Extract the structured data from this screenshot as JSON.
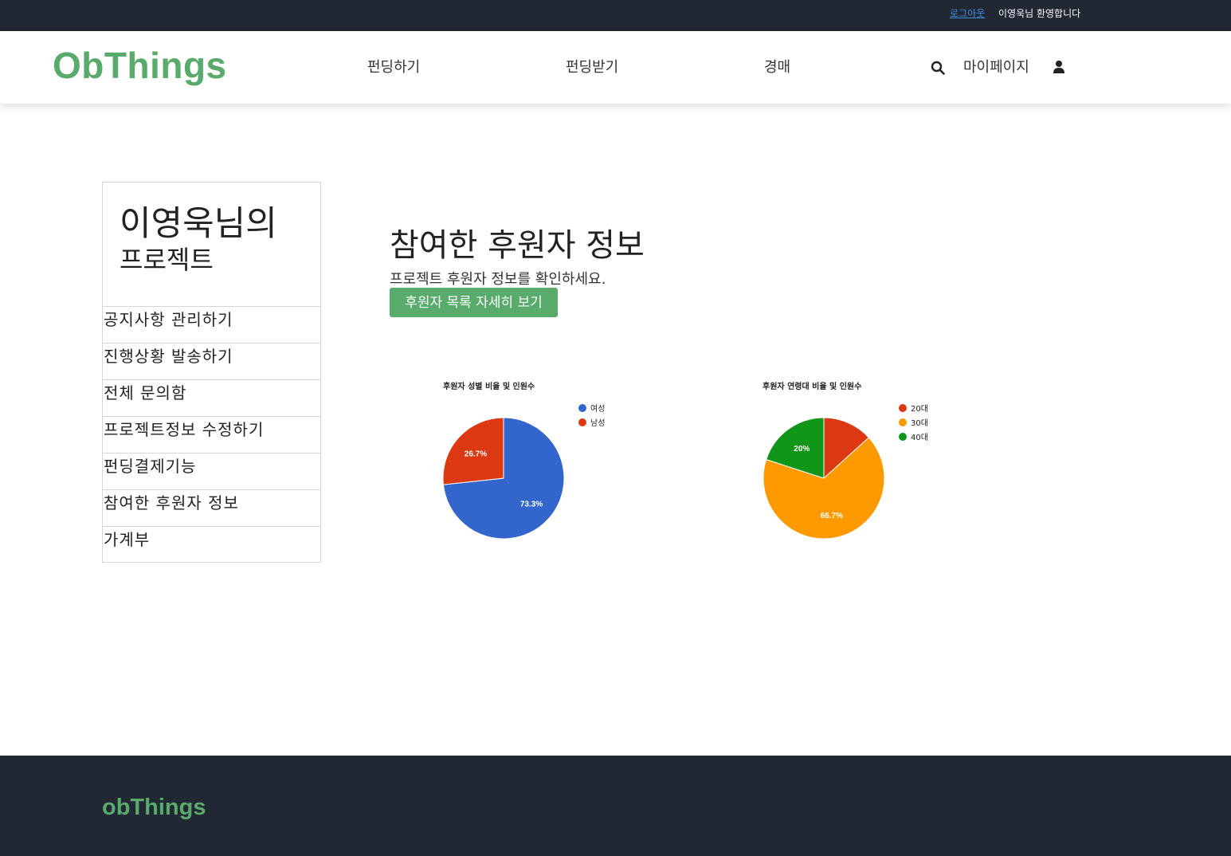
{
  "topbar": {
    "logout": "로그아웃",
    "welcome": "이영욱님 환영합니다"
  },
  "nav": {
    "brand": "ObThings",
    "links": [
      "펀딩하기",
      "펀딩받기",
      "경매"
    ],
    "mypage": "마이페이지"
  },
  "sidebar": {
    "title_line1": "이영욱님의",
    "title_line2": "프로젝트",
    "items": [
      "공지사항 관리하기",
      "진행상황 발송하기",
      "전체 문의함",
      "프로젝트정보 수정하기",
      "펀딩결제기능",
      "참여한 후원자 정보",
      "가계부"
    ]
  },
  "main": {
    "title": "참여한 후원자 정보",
    "subtitle": "프로젝트 후원자 정보를 확인하세요.",
    "button": "후원자 목록 자세히 보기"
  },
  "chart_data": [
    {
      "type": "pie",
      "title": "후원자 성별 비율 및 인원수",
      "categories": [
        "여성",
        "남성"
      ],
      "values": [
        73.3,
        26.7
      ],
      "labels": [
        "73.3%",
        "26.7%"
      ],
      "colors": [
        "#3366cc",
        "#dc3912"
      ],
      "legend": "right"
    },
    {
      "type": "pie",
      "title": "후원자 연령대 비율 및 인원수",
      "categories": [
        "20대",
        "30대",
        "40대"
      ],
      "values": [
        13.3,
        66.7,
        20
      ],
      "labels": [
        "",
        "66.7%",
        "20%"
      ],
      "colors": [
        "#dc3912",
        "#ff9900",
        "#109618"
      ],
      "legend": "right"
    }
  ],
  "footer": {
    "brand": "obThings"
  }
}
